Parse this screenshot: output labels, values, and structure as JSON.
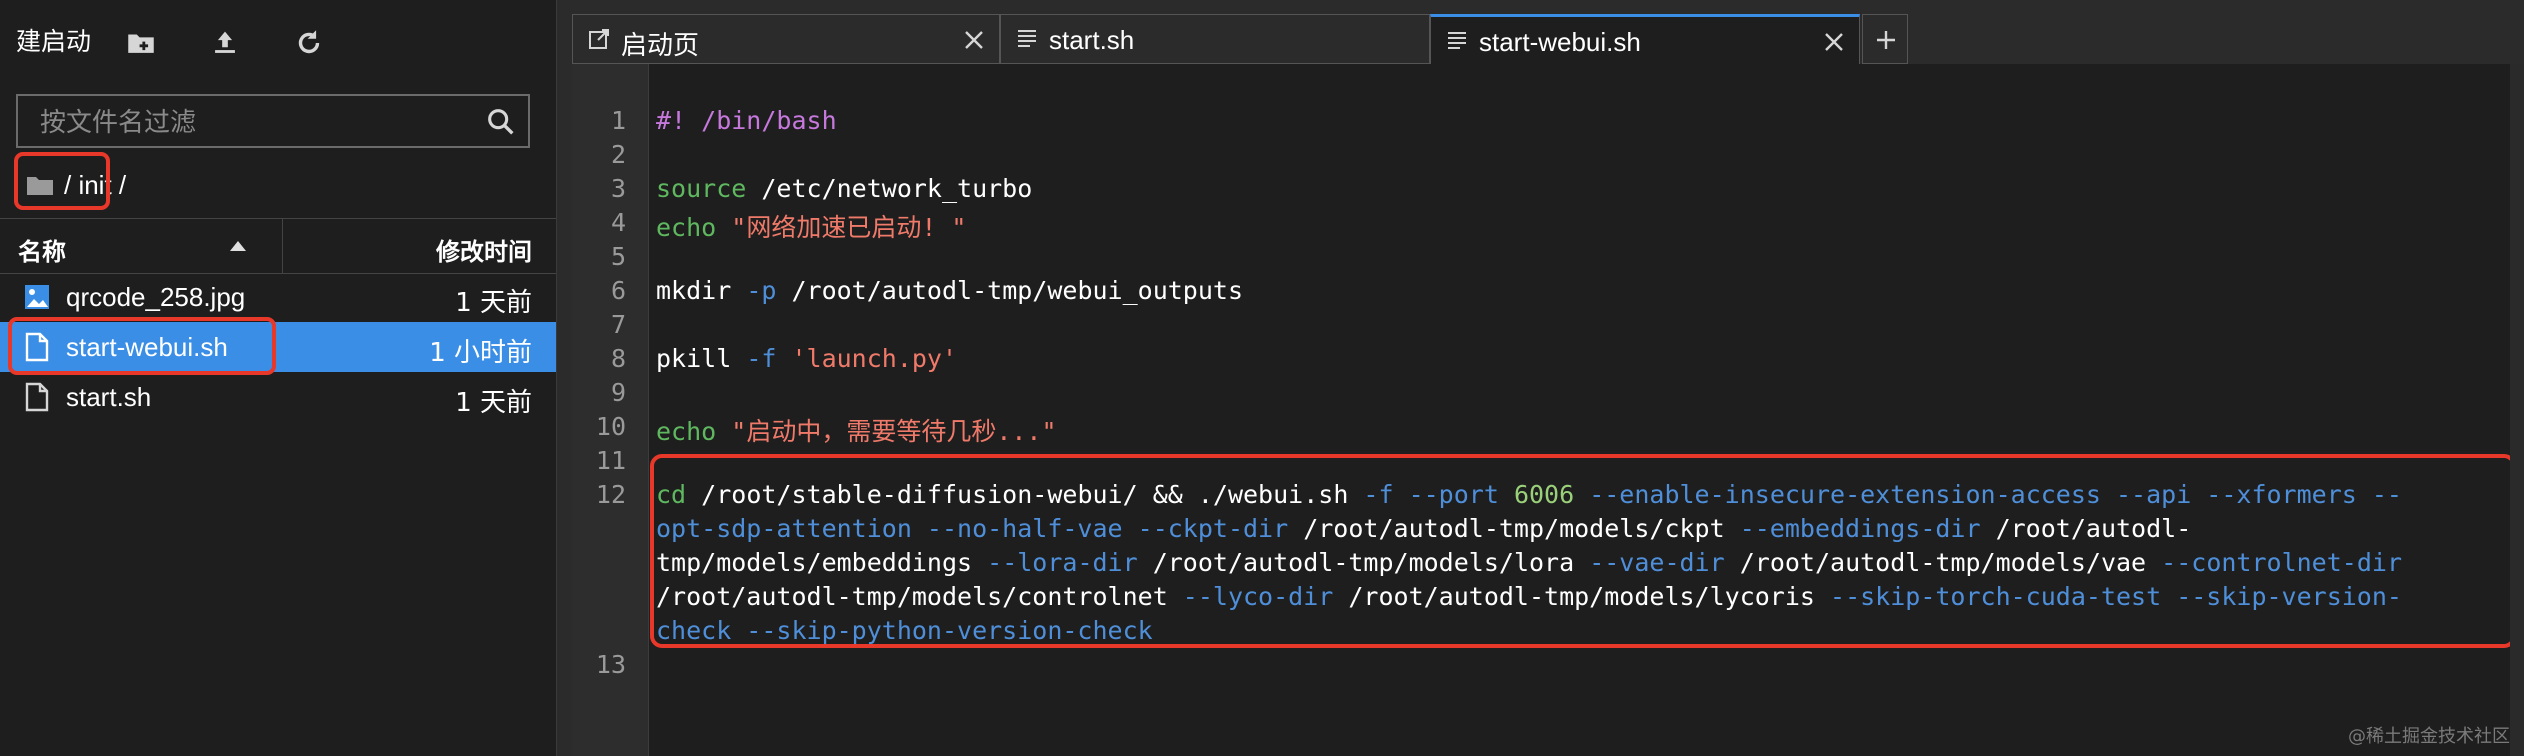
{
  "sidebar": {
    "toolbar_label": "建启动",
    "search_placeholder": "按文件名过滤",
    "breadcrumb": "/ init /",
    "columns": {
      "name": "名称",
      "mtime": "修改时间"
    },
    "files": [
      {
        "name": "qrcode_258.jpg",
        "mtime": "1 天前",
        "icon": "image-file-icon",
        "selected": false
      },
      {
        "name": "start-webui.sh",
        "mtime": "1 小时前",
        "icon": "document-file-icon",
        "selected": true
      },
      {
        "name": "start.sh",
        "mtime": "1 天前",
        "icon": "document-file-icon",
        "selected": false
      }
    ]
  },
  "editor": {
    "tabs": [
      {
        "label": "启动页",
        "icon": "external-page-icon",
        "active": false
      },
      {
        "label": "start.sh",
        "icon": "text-lines-icon",
        "active": false
      },
      {
        "label": "start-webui.sh",
        "icon": "text-lines-icon",
        "active": true
      }
    ],
    "line_numbers": [
      "1",
      "2",
      "3",
      "4",
      "5",
      "6",
      "7",
      "8",
      "9",
      "10",
      "11",
      "12",
      "13"
    ],
    "code": {
      "l1": "#! /bin/bash",
      "l3_kw": "source",
      "l3_rest": " /etc/network_turbo",
      "l4_kw": "echo",
      "l4_str": " \"网络加速已启动! \"",
      "l6_cmd": "mkdir ",
      "l6_flag": "-p",
      "l6_rest": " /root/autodl-tmp/webui_outputs",
      "l8_cmd": "pkill ",
      "l8_flag": "-f",
      "l8_str": " 'launch.py'",
      "l10_kw": "echo",
      "l10_str": " \"启动中，需要等待几秒...\"",
      "l12a_kw": "cd",
      "l12a_1": " /root/stable-diffusion-webui/ && ./webui.sh ",
      "l12a_f1": "-f --port",
      "l12a_n": " 6006 ",
      "l12a_f2": "--enable-insecure-extension-access --api --xformers --",
      "l12b_f1": "opt-sdp-attention --no-half-vae --ckpt-dir",
      "l12b_1": " /root/autodl-tmp/models/ckpt ",
      "l12b_f2": "--embeddings-dir",
      "l12b_2": " /root/autodl-",
      "l12c_1": "tmp/models/embeddings ",
      "l12c_f1": "--lora-dir",
      "l12c_2": " /root/autodl-tmp/models/lora ",
      "l12c_f2": "--vae-dir",
      "l12c_3": " /root/autodl-tmp/models/vae ",
      "l12c_f3": "--controlnet-dir",
      "l12d_1": "/root/autodl-tmp/models/controlnet ",
      "l12d_f1": "--lyco-dir",
      "l12d_2": " /root/autodl-tmp/models/lycoris ",
      "l12d_f2": "--skip-torch-cuda-test --skip-version-",
      "l12e_f1": "check --skip-python-version-check"
    }
  },
  "watermark": "@稀土掘金技术社区",
  "colors": {
    "accent": "#3b8ee6",
    "highlight_box": "#e8382a",
    "keyword": "#5fb85f",
    "flag": "#4f8fd9",
    "string": "#f07a6a",
    "comment": "#c678dd"
  }
}
